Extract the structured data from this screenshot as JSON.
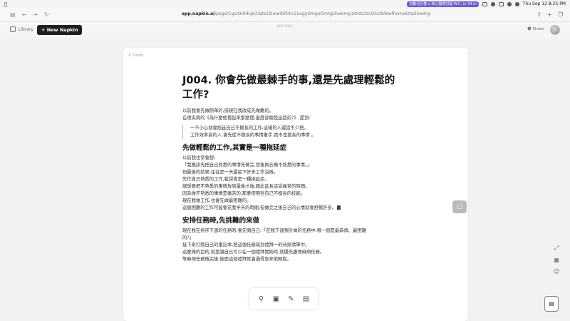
{
  "menubar": {
    "meeting": "自動化社群 x 核心團隊討論 W3 , in 34 m",
    "datetime": "Thu Sep 12  8:25 PM"
  },
  "browser": {
    "url_host": "app.napkin.ai",
    "url_path": "/page/CgoiOHhbyb2iqtb25leiwibFbhc2uagyOmgeOmtgShwemyjatnds3zcOSntbWwfhcmwiztqSnwilng"
  },
  "header": {
    "library_label": "Library",
    "new_button": "+ New Napkin",
    "breadcrumb": "2403-2/3/3",
    "share_label": "Share"
  },
  "editor": {
    "undo_label": "Undo",
    "title": "J004. 你會先做最棘手的事,還是先處理輕鬆的工作?",
    "intro": [
      "以前我會先做簡單的,但現在我改成先做難的。",
      "在理央周的《為什麼他看起來那麼閒,進度卻總是延超前?》 提到:"
    ],
    "quote": [
      "一不小心就會拖延自己不擅長的工作,這樣的人還話不少把。",
      "工作效率高的人,會先從不擅長的事情著手,而不是擅長的事情 。"
    ],
    "section1_heading": "先做輕鬆的工作,其實是一種拖延症",
    "section1": [
      "以前我也常會想:",
      "「我應該先把自己熟悉的事情先做完,然後再去做不熟悉的事情。」",
      "但最後的結果,往往是一天還留下許多工作沒做。",
      "先作自己熟悉的工作,我誤覺是一種拖延症。",
      "總想要把不熟悉的事情放到最後才做,藉此延長這受痛苦的時間。",
      "因為做不熟悉的事情是痛苦的,那要使用到自己不擅長的技能。",
      "現在我做工作,也會先做最困難的。",
      "這個困難的工作可能會花我半天的時間,但做完之後自己的心情就會舒暢許多。"
    ],
    "section2_heading": "安排任務時,先挑難的來做",
    "section2": [
      "現在我在排序下週的任務時,會先問自己:「在我下週預計做的任務中,哪一個是最麻煩、最困難",
      "的?」",
      "接下來打開自己的筆記本,把這個任務寫到禮拜一的待辦清單中。",
      "這麼做的目的,就是讓自己可以在一個禮拜開始時,就優先處理麻煩任務。",
      "等麻煩任務做完後,後面這個禮拜就會過得愈來愈輕鬆。"
    ]
  },
  "tools": [
    "search-sparkle",
    "text-box",
    "pen",
    "image"
  ]
}
